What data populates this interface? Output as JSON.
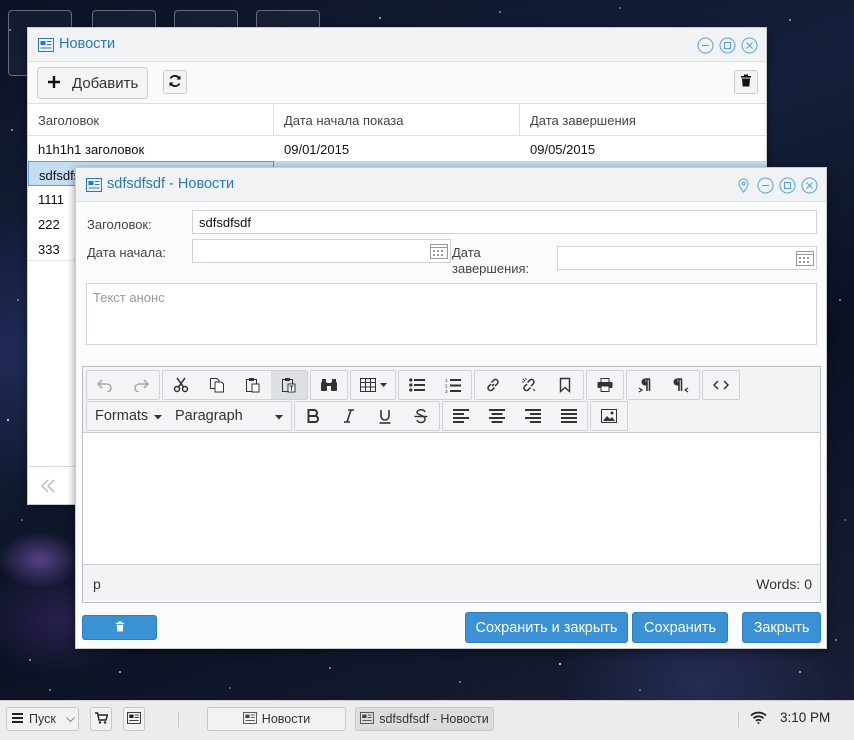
{
  "news_window": {
    "title": "Новости",
    "add_label": "Добавить",
    "columns": [
      "Заголовок",
      "Дата начала показа",
      "Дата завершения"
    ],
    "rows": [
      [
        "h1h1h1 заголовок",
        "09/01/2015",
        "09/05/2015"
      ],
      [
        "sdfsdfsdf",
        "",
        ""
      ],
      [
        "1111",
        "",
        ""
      ],
      [
        "222",
        "",
        ""
      ],
      [
        "333",
        "",
        ""
      ]
    ]
  },
  "edit_window": {
    "title": "sdfsdfsdf - Новости",
    "title_label": "Заголовок:",
    "title_value": "sdfsdfsdf",
    "start_label": "Дата начала:",
    "end_label": "Дата завершения:",
    "announce_placeholder": "Текст анонс",
    "editor": {
      "formats_label": "Formats",
      "paragraph_label": "Paragraph",
      "path": "p",
      "words": "Words: 0"
    },
    "save_close_label": "Сохранить и закрыть",
    "save_label": "Сохранить",
    "close_label": "Закрыть"
  },
  "taskbar": {
    "start_label": "Пуск",
    "tasks": [
      "Новости",
      "sdfsdfsdf - Новости"
    ],
    "clock": "3:10 PM"
  },
  "colors": {
    "accent": "#3a91d3",
    "title_text": "#2a7ab8",
    "selection": "#c5ddf3"
  }
}
